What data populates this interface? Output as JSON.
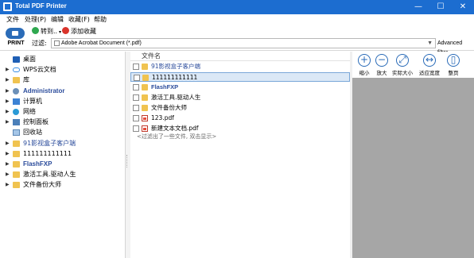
{
  "window": {
    "title": "Total PDF Printer",
    "minimize": "—",
    "maximize": "☐",
    "close": "✕"
  },
  "menu": [
    "文件",
    "处理(P)",
    "编辑",
    "收藏(F)",
    "帮助"
  ],
  "toolbar": {
    "print_label": "PRINT",
    "convert_label": "转到..",
    "favorite_label": "添加收藏",
    "filter_label": "过滤:",
    "filter_value": "Adobe Acrobat Document (*.pdf)",
    "advanced_filter": "Advanced filter"
  },
  "tree": [
    {
      "label": "桌面",
      "icon": "desktop-icon",
      "style": "plain",
      "arrow": ""
    },
    {
      "label": "WPS云文档",
      "icon": "cloud-icon",
      "style": "plain",
      "arrow": "▶"
    },
    {
      "label": "库",
      "icon": "folder-icon",
      "style": "plain",
      "arrow": "▶"
    },
    {
      "label": "Administrator",
      "icon": "user-icon",
      "style": "bluebold",
      "arrow": "▶"
    },
    {
      "label": "计算机",
      "icon": "computer-icon",
      "style": "plain",
      "arrow": "▶"
    },
    {
      "label": "网络",
      "icon": "network-icon",
      "style": "plain",
      "arrow": "▶"
    },
    {
      "label": "控制面板",
      "icon": "control-panel-icon",
      "style": "plain",
      "arrow": "▶"
    },
    {
      "label": "回收站",
      "icon": "recycle-bin-icon",
      "style": "plain",
      "arrow": ""
    },
    {
      "label": "91影视盒子客户端",
      "icon": "folder-icon",
      "style": "blue",
      "arrow": "▶"
    },
    {
      "label": "111111111111",
      "icon": "folder-icon",
      "style": "plain",
      "arrow": "▶"
    },
    {
      "label": "FlashFXP",
      "icon": "folder-icon",
      "style": "bluebold",
      "arrow": "▶"
    },
    {
      "label": "激活工具.驱动人生",
      "icon": "folder-icon",
      "style": "plain",
      "arrow": "▶"
    },
    {
      "label": "文件备份大师",
      "icon": "folder-icon",
      "style": "plain",
      "arrow": "▶"
    }
  ],
  "files": {
    "header": "文件名",
    "rows": [
      {
        "name": "91影视盒子客户端",
        "type": "folder",
        "style": "blue"
      },
      {
        "name": "111111111111",
        "type": "folder",
        "style": "plain"
      },
      {
        "name": "FlashFXP",
        "type": "folder",
        "style": "bluebold"
      },
      {
        "name": "激活工具.驱动人生",
        "type": "folder",
        "style": "plain"
      },
      {
        "name": "文件备份大师",
        "type": "folder",
        "style": "plain"
      },
      {
        "name": "123.pdf",
        "type": "pdf",
        "style": "plain"
      },
      {
        "name": "新建文本文档.pdf",
        "type": "pdf",
        "style": "plain"
      }
    ],
    "hint": "<过滤出了一些文件, 双击显示>"
  },
  "zoom": [
    {
      "label": "缩小",
      "glyph": "+"
    },
    {
      "label": "放大",
      "glyph": "−"
    },
    {
      "label": "实际大小",
      "glyph": "⤢"
    },
    {
      "label": "适应宽度",
      "glyph": "↔"
    },
    {
      "label": "整页",
      "glyph": "▯"
    }
  ]
}
